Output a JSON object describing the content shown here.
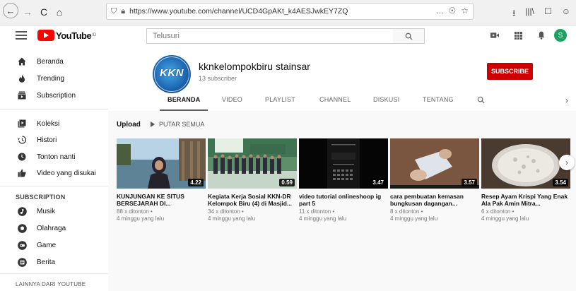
{
  "browser": {
    "url": "https://www.youtube.com/channel/UCD4GpAKt_k4AESJwkEY7ZQ",
    "back_glyph": "←",
    "forward_glyph": "→",
    "reload_glyph": "C",
    "home_glyph": "⌂",
    "url_right_icons": [
      "...",
      "☉",
      "☆"
    ],
    "chrome_right_icons": [
      "⭳",
      "|||\\",
      "☐",
      "☺"
    ]
  },
  "header": {
    "logo_text": "YouTube",
    "logo_suffix": "ID",
    "search_placeholder": "Telusuri",
    "avatar_letter": "S"
  },
  "sidebar": {
    "items": [
      {
        "label": "Beranda",
        "icon": "home-icon"
      },
      {
        "label": "Trending",
        "icon": "flame-icon"
      },
      {
        "label": "Subscription",
        "icon": "subscriptions-icon"
      },
      {
        "label": "Koleksi",
        "icon": "library-icon"
      },
      {
        "label": "Histori",
        "icon": "history-icon"
      },
      {
        "label": "Tonton nanti",
        "icon": "clock-icon"
      },
      {
        "label": "Video yang disukai",
        "icon": "thumbs-up-icon"
      }
    ],
    "subscription_heading": "SUBSCRIPTION",
    "subscriptions": [
      {
        "label": "Musik",
        "icon": "music-icon"
      },
      {
        "label": "Olahraga",
        "icon": "sports-icon"
      },
      {
        "label": "Game",
        "icon": "game-icon"
      },
      {
        "label": "Berita",
        "icon": "news-icon"
      }
    ],
    "more_heading": "LAINNYA DARI YOUTUBE"
  },
  "channel": {
    "avatar_text": "KKN",
    "name": "kknkelompokbiru stainsar",
    "subscribers": "13 subscriber",
    "subscribe_label": "SUBSCRIBE",
    "tabs": [
      "BERANDA",
      "VIDEO",
      "PLAYLIST",
      "CHANNEL",
      "DISKUSI",
      "TENTANG"
    ],
    "active_tab": "BERANDA"
  },
  "shelf": {
    "title": "Upload",
    "play_all_label": "PUTAR SEMUA"
  },
  "videos": [
    {
      "title": "KUNJUNGAN KE SITUS BERSEJARAH DI...",
      "views": "88 x ditonton •",
      "age": "4 minggu yang lalu",
      "duration": "4.22"
    },
    {
      "title": "Kegiata Kerja Sosial KKN-DR Kelompok Biru (4) di Masjid...",
      "views": "34 x ditonton •",
      "age": "4 minggu yang lalu",
      "duration": "0.59"
    },
    {
      "title": "video tutorial onlineshoop ig part 5",
      "views": "11 x ditonton •",
      "age": "4 minggu yang lalu",
      "duration": "3.47"
    },
    {
      "title": "cara pembuatan kemasan bungkusan dagangan...",
      "views": "8 x ditonton •",
      "age": "4 minggu yang lalu",
      "duration": "3.57"
    },
    {
      "title": "Resep Ayam Krispi Yang Enak Ala Pak Amin Mitra...",
      "views": "6 x ditonton •",
      "age": "4 minggu yang lalu",
      "duration": "3.54"
    }
  ],
  "colors": {
    "brand_red": "#ff0000",
    "subscribe_red": "#cc0000",
    "avatar_green": "#1aa260"
  }
}
